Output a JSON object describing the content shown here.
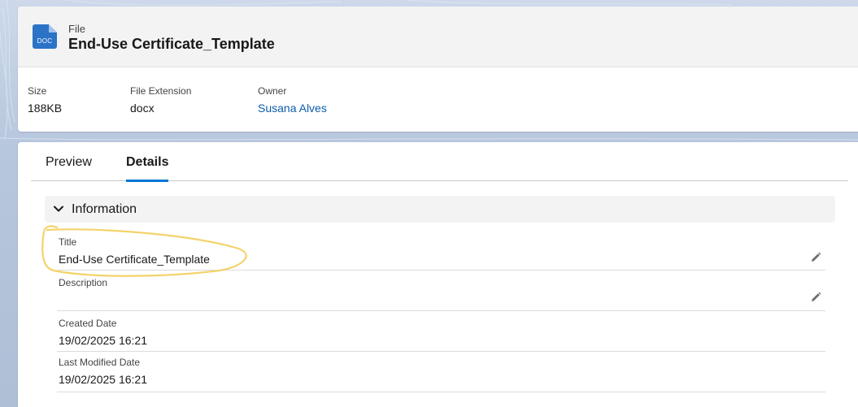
{
  "header": {
    "object_type": "File",
    "title": "End-Use Certificate_Template",
    "icon_text": "DOC",
    "icon_name": "doc-file-icon",
    "icon_color": "#2a73c7",
    "highlights": [
      {
        "label": "Size",
        "value": "188KB"
      },
      {
        "label": "File Extension",
        "value": "docx"
      },
      {
        "label": "Owner",
        "value": "Susana Alves"
      }
    ]
  },
  "tabs": [
    {
      "label": "Preview",
      "active": false
    },
    {
      "label": "Details",
      "active": true
    }
  ],
  "section": {
    "title": "Information",
    "fields": [
      {
        "label": "Title",
        "value": "End-Use Certificate_Template",
        "editable": true
      },
      {
        "label": "Description",
        "value": "",
        "editable": true
      },
      {
        "label": "Created Date",
        "value": "19/02/2025 16:21",
        "editable": false
      },
      {
        "label": "Last Modified Date",
        "value": "19/02/2025 16:21",
        "editable": false
      }
    ]
  },
  "colors": {
    "accent": "#0176d3",
    "link": "#0b5cab",
    "annotation": "#f3d36b"
  }
}
